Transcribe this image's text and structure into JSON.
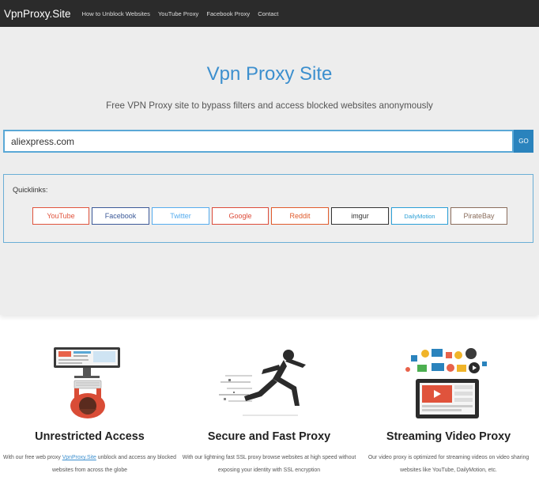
{
  "navbar": {
    "brand": "VpnProxy.Site",
    "links": [
      "How to Unblock Websites",
      "YouTube Proxy",
      "Facebook Proxy",
      "Contact"
    ]
  },
  "hero": {
    "title": "Vpn Proxy Site",
    "subtitle": "Free VPN Proxy site to bypass filters and access blocked websites anonymously",
    "url_value": "aliexpress.com",
    "go_label": "GO"
  },
  "quicklinks": {
    "label": "Quicklinks:",
    "items": [
      {
        "label": "YouTube",
        "color": "#e0533c"
      },
      {
        "label": "Facebook",
        "color": "#3b5998"
      },
      {
        "label": "Twitter",
        "color": "#55acee"
      },
      {
        "label": "Google",
        "color": "#dd4b39"
      },
      {
        "label": "Reddit",
        "color": "#e05a2b"
      },
      {
        "label": "imgur",
        "color": "#333333"
      },
      {
        "label": "DailyMotion",
        "color": "#2a9fd6"
      },
      {
        "label": "PirateBay",
        "color": "#8a6d5c"
      }
    ]
  },
  "features": [
    {
      "title": "Unrestricted Access",
      "text_before": "With our free web proxy ",
      "link": "VpnProxy.Site",
      "text_after": " unblock and access any blocked websites from across the globe",
      "illustration": "computer-user-illustration"
    },
    {
      "title": "Secure and Fast Proxy",
      "text": "With our lightning fast SSL proxy browse websites at high speed without exposing your identity with SSL encryption",
      "illustration": "runner-illustration"
    },
    {
      "title": "Streaming Video Proxy",
      "text": "Our video proxy is optimized for streaming videos on video sharing websites like YouTube, DailyMotion, etc.",
      "illustration": "video-streaming-illustration"
    }
  ],
  "colors": {
    "navbar_bg": "#2b2b2b",
    "hero_bg": "#ededed",
    "accent": "#3c8fce",
    "go_bg": "#2a83bd"
  }
}
